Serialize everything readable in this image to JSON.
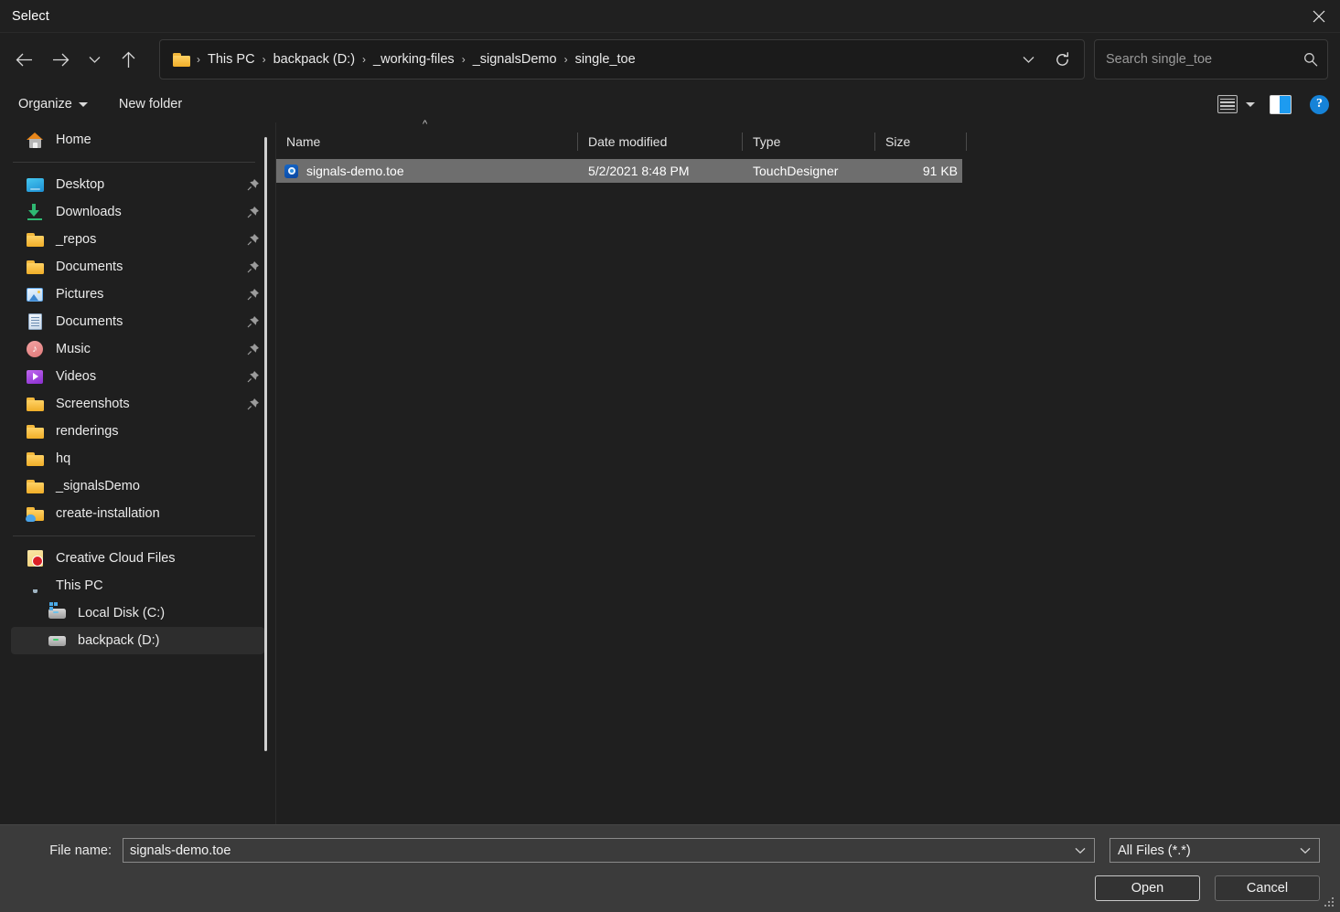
{
  "window": {
    "title": "Select",
    "close_label": "✕"
  },
  "nav": {
    "back": "←",
    "forward": "→",
    "recent": "⌄",
    "up": "↑",
    "dropdown": "⌄",
    "refresh": "⟳"
  },
  "address": {
    "folder_icon": "folder-icon",
    "separator": "›",
    "crumbs": [
      "This PC",
      "backpack (D:)",
      "_working-files",
      "_signalsDemo",
      "single_toe"
    ]
  },
  "search": {
    "placeholder": "Search single_toe",
    "icon": "search-icon"
  },
  "commandbar": {
    "organize": "Organize",
    "new_folder": "New folder",
    "view_icon": "list-view-icon",
    "preview_pane_icon": "preview-pane-icon",
    "help_icon": "help-icon",
    "help_glyph": "?"
  },
  "sidebar": {
    "groups": [
      {
        "items": [
          {
            "label": "Home",
            "icon": "home-icon",
            "pinned": false,
            "selected": false,
            "indent": 0
          }
        ]
      },
      {
        "items": [
          {
            "label": "Desktop",
            "icon": "desktop-monitor-icon",
            "pinned": true,
            "selected": false,
            "indent": 0
          },
          {
            "label": "Downloads",
            "icon": "download-arrow-icon",
            "pinned": true,
            "selected": false,
            "indent": 0
          },
          {
            "label": "_repos",
            "icon": "folder-icon",
            "pinned": true,
            "selected": false,
            "indent": 0
          },
          {
            "label": "Documents",
            "icon": "folder-icon",
            "pinned": true,
            "selected": false,
            "indent": 0
          },
          {
            "label": "Pictures",
            "icon": "pictures-icon",
            "pinned": true,
            "selected": false,
            "indent": 0
          },
          {
            "label": "Documents",
            "icon": "document-icon",
            "pinned": true,
            "selected": false,
            "indent": 0
          },
          {
            "label": "Music",
            "icon": "music-note-icon",
            "pinned": true,
            "selected": false,
            "indent": 0
          },
          {
            "label": "Videos",
            "icon": "video-play-icon",
            "pinned": true,
            "selected": false,
            "indent": 0
          },
          {
            "label": "Screenshots",
            "icon": "folder-icon",
            "pinned": true,
            "selected": false,
            "indent": 0
          },
          {
            "label": "renderings",
            "icon": "folder-icon",
            "pinned": false,
            "selected": false,
            "indent": 0
          },
          {
            "label": "hq",
            "icon": "folder-icon",
            "pinned": false,
            "selected": false,
            "indent": 0
          },
          {
            "label": "_signalsDemo",
            "icon": "folder-icon",
            "pinned": false,
            "selected": false,
            "indent": 0
          },
          {
            "label": "create-installation",
            "icon": "folder-cloud-icon",
            "pinned": false,
            "selected": false,
            "indent": 0
          }
        ]
      },
      {
        "items": [
          {
            "label": "Creative Cloud Files",
            "icon": "creative-cloud-icon",
            "pinned": false,
            "selected": false,
            "indent": 0
          },
          {
            "label": "This PC",
            "icon": "this-pc-icon",
            "pinned": false,
            "selected": false,
            "indent": 0
          },
          {
            "label": "Local Disk (C:)",
            "icon": "disk-drive-windows-icon",
            "pinned": false,
            "selected": false,
            "indent": 1
          },
          {
            "label": "backpack (D:)",
            "icon": "disk-drive-icon",
            "pinned": false,
            "selected": true,
            "indent": 1
          }
        ]
      }
    ]
  },
  "filelist": {
    "columns": [
      "Name",
      "Date modified",
      "Type",
      "Size"
    ],
    "sort_column": "Name",
    "sort_caret": "^",
    "rows": [
      {
        "name": "signals-demo.toe",
        "date_modified": "5/2/2021 8:48 PM",
        "type": "TouchDesigner",
        "size": "91 KB",
        "icon": "touchdesigner-file-icon",
        "selected": true
      }
    ]
  },
  "footer": {
    "filename_label": "File name:",
    "filename_value": "signals-demo.toe",
    "filetype_value": "All Files (*.*)",
    "open_label": "Open",
    "cancel_label": "Cancel"
  }
}
